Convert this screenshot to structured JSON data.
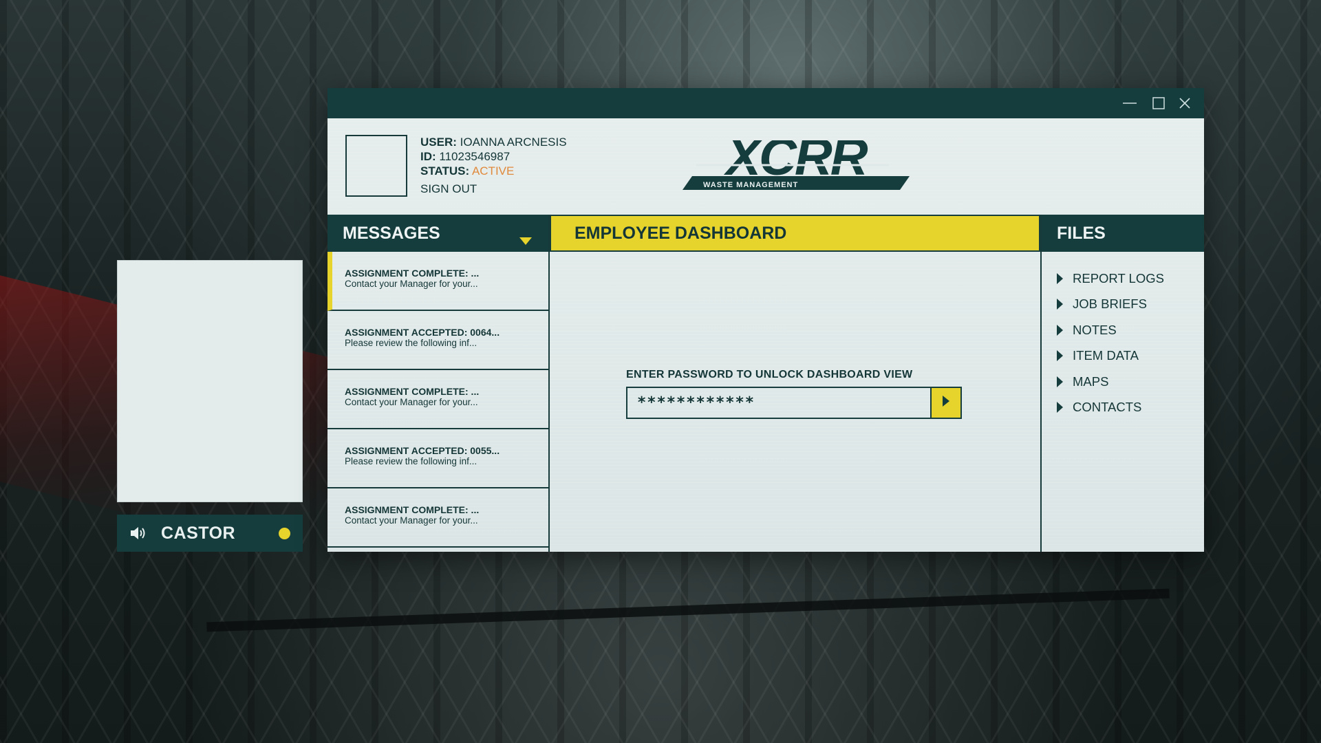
{
  "background": {
    "accent_red": "#8a1414"
  },
  "camera": {
    "name": "CASTOR",
    "status_color": "#e6d32b",
    "speaker_icon": "speaker-icon"
  },
  "window": {
    "controls": [
      "minimize-icon",
      "maximize-icon",
      "close-icon"
    ]
  },
  "user": {
    "user_label": "USER:",
    "user_value": "IOANNA ARCNESIS",
    "id_label": "ID:",
    "id_value": "11023546987",
    "status_label": "STATUS:",
    "status_value": "ACTIVE",
    "sign_out": "SIGN OUT"
  },
  "logo": {
    "text": "XCRR",
    "subtitle": "WASTE MANAGEMENT"
  },
  "messages": {
    "header": "MESSAGES",
    "items": [
      {
        "title": "ASSIGNMENT COMPLETE: ...",
        "preview": "Contact your Manager for your..."
      },
      {
        "title": "ASSIGNMENT ACCEPTED: 0064...",
        "preview": "Please review the following inf..."
      },
      {
        "title": "ASSIGNMENT COMPLETE: ...",
        "preview": "Contact your Manager for your..."
      },
      {
        "title": "ASSIGNMENT ACCEPTED: 0055...",
        "preview": "Please review the following inf..."
      },
      {
        "title": "ASSIGNMENT COMPLETE: ...",
        "preview": "Contact your Manager for your..."
      }
    ]
  },
  "dashboard": {
    "header": "EMPLOYEE DASHBOARD",
    "password_label": "ENTER PASSWORD TO UNLOCK DASHBOARD VIEW",
    "password_value": "************"
  },
  "files": {
    "header": "FILES",
    "items": [
      "REPORT LOGS",
      "JOB BRIEFS",
      "NOTES",
      "ITEM DATA",
      "MAPS",
      "CONTACTS"
    ]
  },
  "colors": {
    "primary": "#163d3d",
    "accent": "#e6d32b",
    "status_active": "#e08a3c",
    "panel": "#dfe8e8"
  }
}
